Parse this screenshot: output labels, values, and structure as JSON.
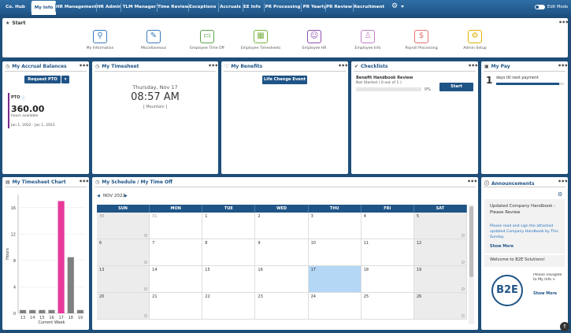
{
  "nav": {
    "items": [
      "Co. Hub",
      "My Info",
      "HR Management",
      "HR Admin",
      "TLM Manager",
      "Time Review",
      "Exceptions",
      "Accruals",
      "EE Info",
      "PR Processing",
      "PR Yearly",
      "PR Review",
      "Recruitment"
    ],
    "active": "My Info",
    "edit_mode": "Edit Mode"
  },
  "start": {
    "title": "Start",
    "tiles": [
      {
        "label": "My Information",
        "icon": "search-person-icon"
      },
      {
        "label": "Miscellaneous",
        "icon": "pencil-document-icon"
      },
      {
        "label": "Employee Time Off",
        "icon": "briefcase-icon"
      },
      {
        "label": "Employee Timesheets",
        "icon": "timesheet-grid-icon"
      },
      {
        "label": "Employee HR",
        "icon": "people-circle-icon"
      },
      {
        "label": "Employee Info",
        "icon": "person-info-icon"
      },
      {
        "label": "Payroll Processing",
        "icon": "payroll-check-icon"
      },
      {
        "label": "Admin Setup",
        "icon": "gears-icon"
      }
    ]
  },
  "accrual": {
    "title": "My Accrual Balances",
    "button": "Request PTO",
    "type": "PTO",
    "hours": "360.00",
    "hours_label": "hours available",
    "period": "Jan 1, 2022 - Jan 1, 2023"
  },
  "timesheet": {
    "title": "My Timesheet",
    "date": "Thursday, Nov 17",
    "time": "08:57 AM",
    "zone": "[ Mountain ]"
  },
  "benefits": {
    "title": "My Benefits",
    "button": "Life Change Event"
  },
  "checklists": {
    "title": "Checklists",
    "item": "Benefit Handbook Review",
    "status": "Not Started ( 0 out of 1 )",
    "percent": "0%",
    "button": "Start"
  },
  "pay": {
    "title": "My Pay",
    "days": "1",
    "label": "days till next payment",
    "progress": 0.93
  },
  "chart": {
    "title": "My Timesheet Chart"
  },
  "chart_data": {
    "type": "bar",
    "categories": [
      "13",
      "14",
      "15",
      "16",
      "17",
      "18",
      "19"
    ],
    "values": [
      0.5,
      0.5,
      0.5,
      0.5,
      17,
      8.5,
      0.5
    ],
    "colors": [
      "#808080",
      "#808080",
      "#808080",
      "#808080",
      "#e8399a",
      "#808080",
      "#808080"
    ],
    "ylabel": "Hours",
    "xlabel": "Current Week",
    "yticks": [
      0,
      4,
      8,
      12,
      16
    ],
    "ylim": [
      0,
      18
    ]
  },
  "schedule": {
    "title": "My Schedule / My Time Off",
    "month": "NOV 2022",
    "days": [
      "SUN",
      "MON",
      "TUE",
      "WED",
      "THU",
      "FRI",
      "SAT"
    ],
    "weeks": [
      [
        "30",
        "31",
        "1",
        "2",
        "3",
        "4",
        "5"
      ],
      [
        "6",
        "7",
        "8",
        "9",
        "10",
        "11",
        "12"
      ],
      [
        "13",
        "14",
        "15",
        "16",
        "17",
        "18",
        "19"
      ],
      [
        "20",
        "21",
        "22",
        "23",
        "24",
        "25",
        "26"
      ]
    ]
  },
  "announcements": {
    "title": "Announcements",
    "item1_title": "Updated Company Handbook - Please Review",
    "item1_body": "Please read and sign the attached updated Company Handbook by This Sunday.",
    "show_more": "Show More",
    "item2_title": "Welcome to B2E Solutions!",
    "item2_body": "Please navigate to My Info >",
    "logo": "B2E"
  }
}
